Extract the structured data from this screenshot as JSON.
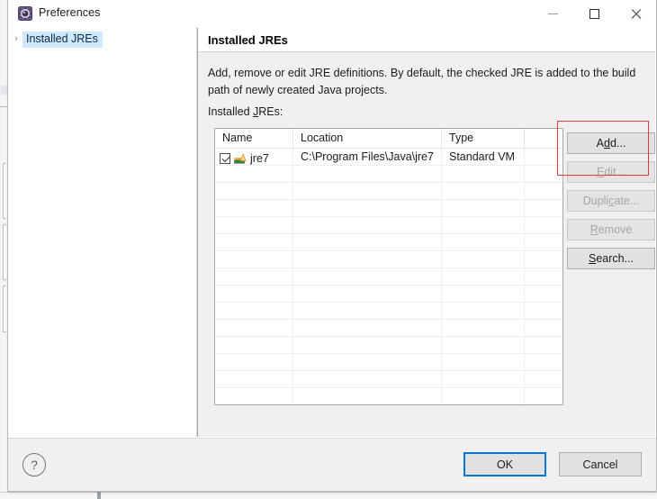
{
  "window": {
    "title": "Preferences",
    "icon": "preferences-gear-icon",
    "controls": {
      "minimize": "minimize-icon",
      "maximize": "maximize-icon",
      "close": "close-icon"
    }
  },
  "sidebar": {
    "items": [
      {
        "label": "Installed JREs",
        "arrow": "›",
        "selected": true
      }
    ]
  },
  "page": {
    "title": "Installed JREs",
    "description": "Add, remove or edit JRE definitions. By default, the checked JRE is added to the build path of newly created Java projects.",
    "list_label_prefix": "Installed ",
    "list_label_mnemonic": "J",
    "list_label_suffix": "REs:"
  },
  "table": {
    "columns": [
      "Name",
      "Location",
      "Type"
    ],
    "rows": [
      {
        "checked": true,
        "icon": "jre-icon",
        "name": "jre7",
        "location": "C:\\Program Files\\Java\\jre7",
        "type": "Standard VM"
      }
    ],
    "empty_row_count": 15
  },
  "side_buttons": [
    {
      "id": "add",
      "pre": "A",
      "mnemonic": "d",
      "post": "d...",
      "label": "Add...",
      "enabled": true,
      "highlighted": true
    },
    {
      "id": "edit",
      "pre": "",
      "mnemonic": "E",
      "post": "dit...",
      "label": "Edit...",
      "enabled": false,
      "highlighted": false
    },
    {
      "id": "duplicate",
      "pre": "Dupli",
      "mnemonic": "c",
      "post": "ate...",
      "label": "Duplicate...",
      "enabled": false,
      "highlighted": false
    },
    {
      "id": "remove",
      "pre": "",
      "mnemonic": "R",
      "post": "emove",
      "label": "Remove",
      "enabled": false,
      "highlighted": false
    },
    {
      "id": "search",
      "pre": "",
      "mnemonic": "S",
      "post": "earch...",
      "label": "Search...",
      "enabled": true,
      "highlighted": false
    }
  ],
  "footer": {
    "help_glyph": "?",
    "ok_label": "OK",
    "cancel_label": "Cancel"
  },
  "colors": {
    "accent_focus": "#0078d7",
    "highlight_box": "#e03b3b",
    "selection": "#cde8ff",
    "dialog_bg": "#f0f0f0"
  }
}
